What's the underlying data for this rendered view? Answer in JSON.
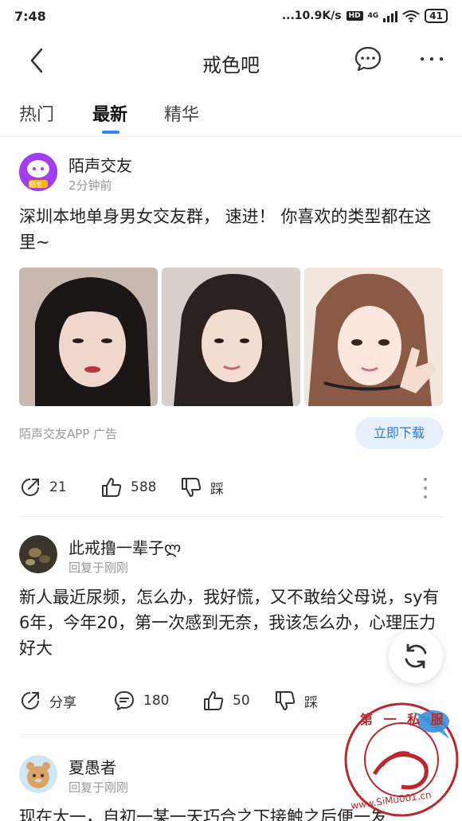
{
  "status_bar": {
    "time": "7:48",
    "speed": "...10.9K/s",
    "hd": "HD",
    "network": "4G",
    "battery": "41"
  },
  "nav": {
    "title": "戒色吧"
  },
  "tabs": [
    {
      "label": "热门"
    },
    {
      "label": "最新"
    },
    {
      "label": "精华"
    }
  ],
  "ad_post": {
    "author": "陌声交友",
    "time": "2分钟前",
    "avatar_badge": "陌里",
    "text": "深圳本地单身男女交友群， 速进！ 你喜欢的类型都在这里~",
    "ad_label": "陌声交友APP  广告",
    "download_label": "立即下载",
    "repost_count": "21",
    "like_count": "588",
    "dislike_label": "踩"
  },
  "post2": {
    "author": "此戒撸一辈子ლ",
    "time": "回复于刚刚",
    "text": "新人最近尿频，怎么办，我好慌，又不敢给父母说，sy有6年，今年20，第一次感到无奈，我该怎么办，心理压力好大",
    "share_label": "分享",
    "comment_count": "180",
    "like_count": "50",
    "dislike_label": "踩"
  },
  "post3": {
    "author": "夏愚者",
    "time": "回复于刚刚",
    "text": "现在大一，自初一某一天巧合之下接触之后便一发"
  },
  "watermark": {
    "top_text": "第 一 私 服",
    "bottom_text": "www.SiMu001.cn"
  },
  "colors": {
    "accent": "#3388ff",
    "download_bg": "#e6f1fb",
    "download_text": "#2a79e2",
    "watermark_red": "#b8282d"
  }
}
